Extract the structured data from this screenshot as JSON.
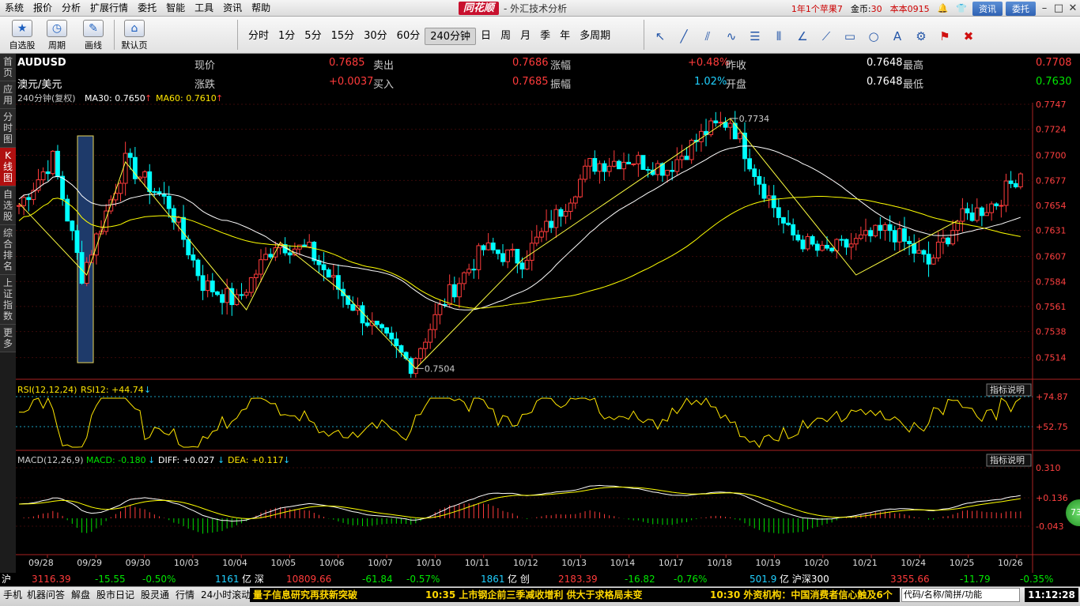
{
  "menu": [
    "系统",
    "报价",
    "分析",
    "扩展行情",
    "委托",
    "智能",
    "工具",
    "资讯",
    "帮助"
  ],
  "brand": {
    "logo": "同花顺",
    "title": "- 外汇技术分析"
  },
  "top_right": {
    "promo": "1年1个苹果7",
    "coins_label": "金币:",
    "coins": "30",
    "user": "本本0915",
    "news_btn": "资讯",
    "trade_btn": "委托"
  },
  "toolbar": {
    "buttons": [
      "自选股",
      "周期",
      "画线",
      "默认页"
    ],
    "periods": [
      "分时",
      "1分",
      "5分",
      "15分",
      "30分",
      "60分",
      "240分钟",
      "日",
      "周",
      "月",
      "季",
      "年",
      "多周期"
    ],
    "active_period": "240分钟"
  },
  "leftbar": [
    "首页",
    "应用",
    "分时图",
    "K线图",
    "自选股",
    "综合排名",
    "上证指数",
    "更多"
  ],
  "quote": {
    "symbol": "AUDUSD",
    "name": "澳元/美元",
    "labels": {
      "price": "现价",
      "change": "涨跌",
      "sell": "卖出",
      "buy": "买入",
      "pct": "涨幅",
      "amp": "振幅",
      "prev": "昨收",
      "open": "开盘",
      "high": "最高",
      "low": "最低"
    },
    "price": "0.7685",
    "change": "+0.0037",
    "sell": "0.7686",
    "buy": "0.7685",
    "pct": "+0.48%",
    "amp": "1.02%",
    "prev": "0.7648",
    "open": "0.7648",
    "high": "0.7708",
    "low": "0.7630"
  },
  "ma_legend": {
    "period": "240分钟(复权)",
    "ma30": "MA30: 0.7650",
    "ma60": "MA60: 0.7610"
  },
  "rsi_legend": {
    "label": "RSI(12,12,24)",
    "value": "RSI12: +44.74",
    "help": "指标说明"
  },
  "macd_legend": {
    "label": "MACD(12,26,9)",
    "macd": "MACD: -0.180",
    "diff": "DIFF: +0.027",
    "dea": "DEA: +0.117",
    "help": "指标说明"
  },
  "chart_data": {
    "type": "candlestick",
    "price_axis": [
      0.7747,
      0.7724,
      0.77,
      0.7677,
      0.7654,
      0.7631,
      0.7607,
      0.7584,
      0.7561,
      0.7538,
      0.7514
    ],
    "ylim": [
      0.7497,
      0.7747
    ],
    "annotations": [
      {
        "label": "0.7734"
      },
      {
        "label": "0.7504"
      }
    ],
    "rsi_axis": [
      "+74.87",
      "+52.75"
    ],
    "macd_axis": [
      "0.310",
      "+0.136",
      "-0.043"
    ],
    "dates": [
      "09/28",
      "09/29",
      "09/30",
      "10/03",
      "10/04",
      "10/05",
      "10/06",
      "10/07",
      "10/10",
      "10/11",
      "10/12",
      "10/13",
      "10/14",
      "10/17",
      "10/18",
      "10/19",
      "10/20",
      "10/21",
      "10/24",
      "10/25",
      "10/26"
    ],
    "colors": {
      "up": "#ff3b3b",
      "down": "#00ffff",
      "ma30": "#ffffff",
      "ma60": "#ffff00",
      "zigzag": "#ffff40"
    },
    "keypoints": [
      [
        0,
        0.7654
      ],
      [
        7,
        0.7697
      ],
      [
        13,
        0.759
      ],
      [
        22,
        0.7694
      ],
      [
        31,
        0.7655
      ],
      [
        38,
        0.7582
      ],
      [
        45,
        0.7565
      ],
      [
        53,
        0.762
      ],
      [
        60,
        0.7612
      ],
      [
        67,
        0.7572
      ],
      [
        75,
        0.7533
      ],
      [
        81,
        0.7508
      ],
      [
        88,
        0.7567
      ],
      [
        96,
        0.7614
      ],
      [
        104,
        0.7604
      ],
      [
        112,
        0.765
      ],
      [
        118,
        0.7691
      ],
      [
        126,
        0.7697
      ],
      [
        134,
        0.7688
      ],
      [
        142,
        0.7722
      ],
      [
        147,
        0.7732
      ],
      [
        153,
        0.7677
      ],
      [
        159,
        0.7629
      ],
      [
        166,
        0.761
      ],
      [
        173,
        0.762
      ],
      [
        180,
        0.7632
      ],
      [
        188,
        0.76
      ],
      [
        194,
        0.764
      ],
      [
        202,
        0.7657
      ],
      [
        207,
        0.7685
      ]
    ]
  }
}
